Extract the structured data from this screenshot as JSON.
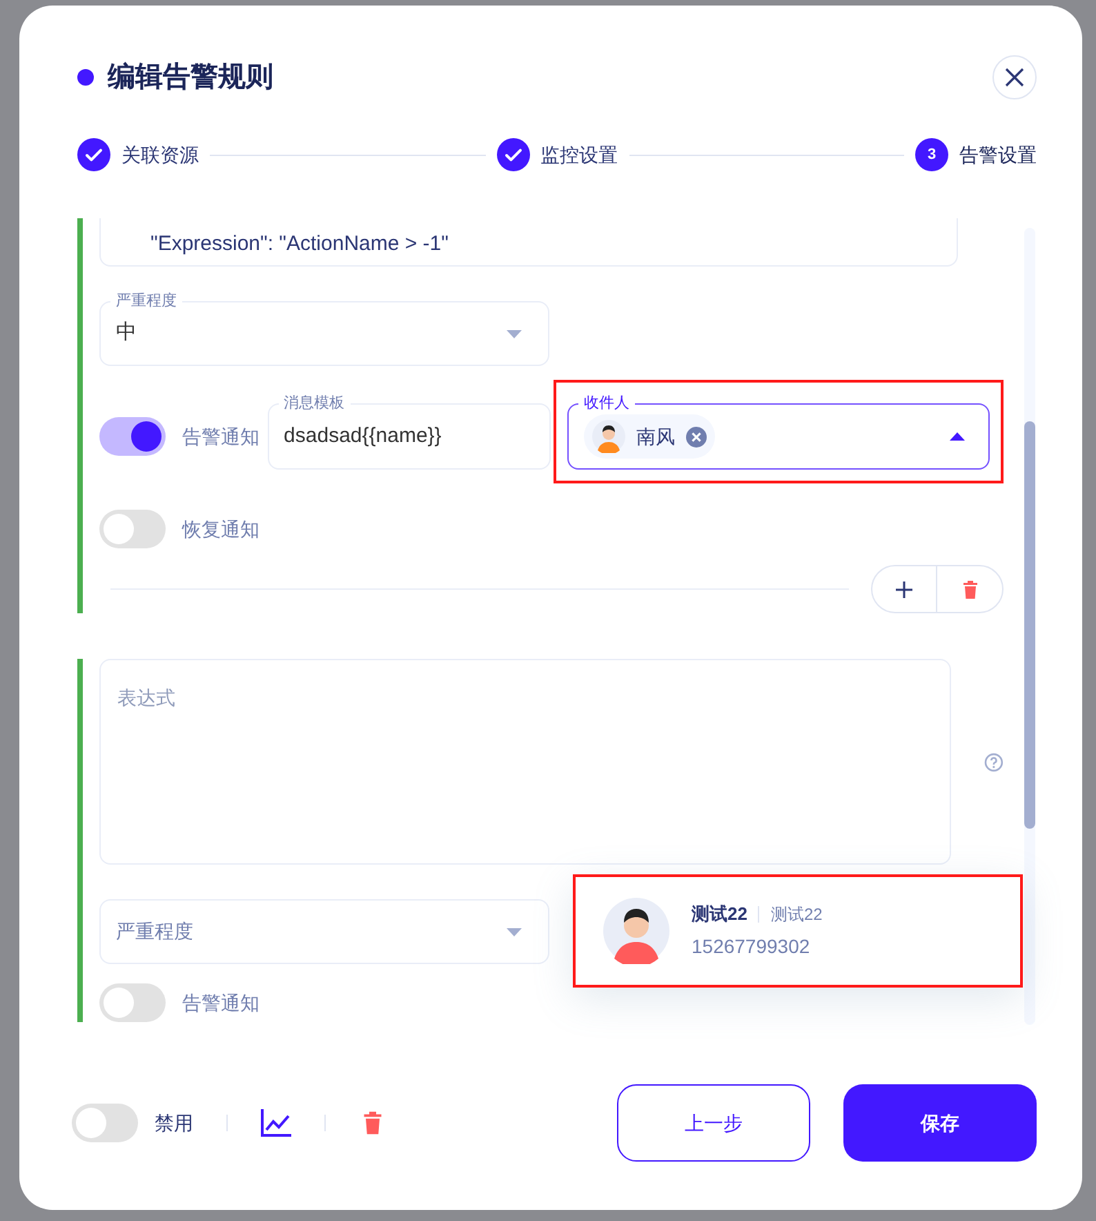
{
  "dialog": {
    "title": "编辑告警规则"
  },
  "steps": [
    {
      "label": "关联资源",
      "done": true
    },
    {
      "label": "监控设置",
      "done": true
    },
    {
      "label": "告警设置",
      "number": "3",
      "done": false
    }
  ],
  "rules": [
    {
      "expression": "\"Expression\": \"ActionName > -1\"",
      "severity": {
        "label": "严重程度",
        "value": "中"
      },
      "alert_notify": {
        "label": "告警通知",
        "on": true
      },
      "template": {
        "label": "消息模板",
        "value": "dsadsad{{name}}"
      },
      "recipients": {
        "label": "收件人",
        "chips": [
          {
            "name": "南风"
          }
        ],
        "open": true,
        "highlighted": true
      },
      "recovery_notify": {
        "label": "恢复通知",
        "on": false
      }
    },
    {
      "expression_placeholder": "表达式",
      "severity": {
        "placeholder": "严重程度"
      },
      "alert_notify": {
        "label": "告警通知",
        "on": false
      }
    }
  ],
  "recipient_options": [
    {
      "name": "测试22",
      "alias": "测试22",
      "phone": "15267799302",
      "highlighted": true
    }
  ],
  "footer": {
    "disable": {
      "label": "禁用",
      "on": false
    },
    "buttons": [
      {
        "label": "上一步",
        "kind": "outline"
      },
      {
        "label": "保存",
        "kind": "primary"
      }
    ]
  }
}
